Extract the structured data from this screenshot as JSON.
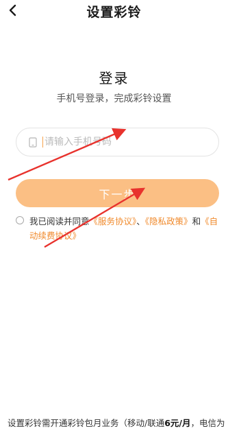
{
  "nav": {
    "back_icon": "chevron-left-icon",
    "title": "设置彩铃"
  },
  "login": {
    "title": "登录",
    "subtitle": "手机号登录，完成彩铃设置"
  },
  "phone_input": {
    "icon": "phone-icon",
    "placeholder": "请输入手机号码",
    "value": ""
  },
  "next_button": {
    "label": "下一步",
    "color": "#fbbf84"
  },
  "agreement": {
    "checked": false,
    "prefix": "我已阅读并同意",
    "service_link": "《服务协议》",
    "separator": "、",
    "privacy_link": "《隐私政策》",
    "and": "和",
    "auto_renew_link": "《自动续费协议》",
    "link_color": "#f08a2c"
  },
  "footer": {
    "text_before": "设置彩铃需开通彩铃包月业务（移动/联通",
    "price": "6元/月",
    "text_after": "，电信为"
  },
  "annotation_colors": {
    "arrow": "#e8322d"
  }
}
